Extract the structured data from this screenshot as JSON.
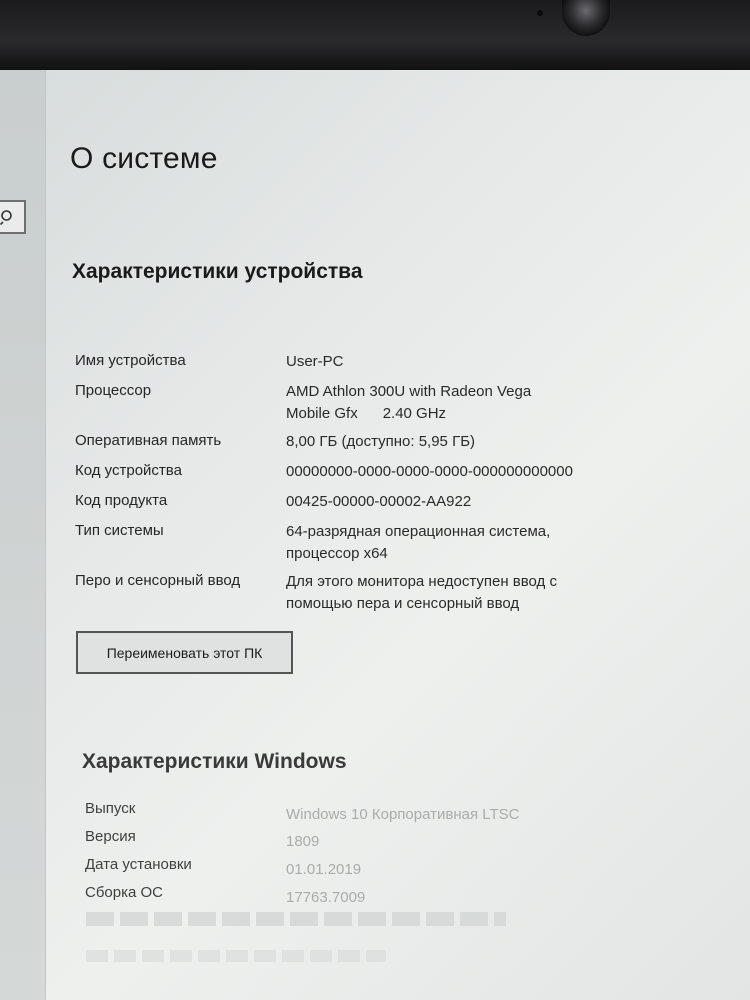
{
  "page": {
    "title": "О системе"
  },
  "device": {
    "section_title": "Характеристики устройства",
    "specs": [
      {
        "label": "Имя устройства",
        "value": "User-PC"
      },
      {
        "label": "Процессор",
        "value_line1": "AMD Athlon 300U with Radeon Vega",
        "value_line2": "Mobile Gfx      2.40 GHz"
      },
      {
        "label": "Оперативная память",
        "value": "8,00 ГБ (доступно: 5,95 ГБ)"
      },
      {
        "label": "Код устройства",
        "value": "00000000-0000-0000-0000-000000000000"
      },
      {
        "label": "Код продукта",
        "value": "00425-00000-00002-AA922"
      },
      {
        "label": "Тип системы",
        "value_line1": "64-разрядная операционная система,",
        "value_line2": "процессор x64"
      },
      {
        "label": "Перо и сенсорный ввод",
        "value_line1": "Для этого монитора недоступен ввод с",
        "value_line2": "помощью пера и сенсорный ввод"
      }
    ],
    "rename_button": "Переименовать этот ПК"
  },
  "windows": {
    "section_title": "Характеристики Windows",
    "specs": [
      {
        "label": "Выпуск",
        "value": "Windows 10 Корпоративная LTSC"
      },
      {
        "label": "Версия",
        "value": "1809"
      },
      {
        "label": "Дата установки",
        "value": "01.01.2019"
      },
      {
        "label": "Сборка ОС",
        "value": "17763.7009"
      }
    ]
  },
  "icons": {
    "search": "search-icon"
  }
}
